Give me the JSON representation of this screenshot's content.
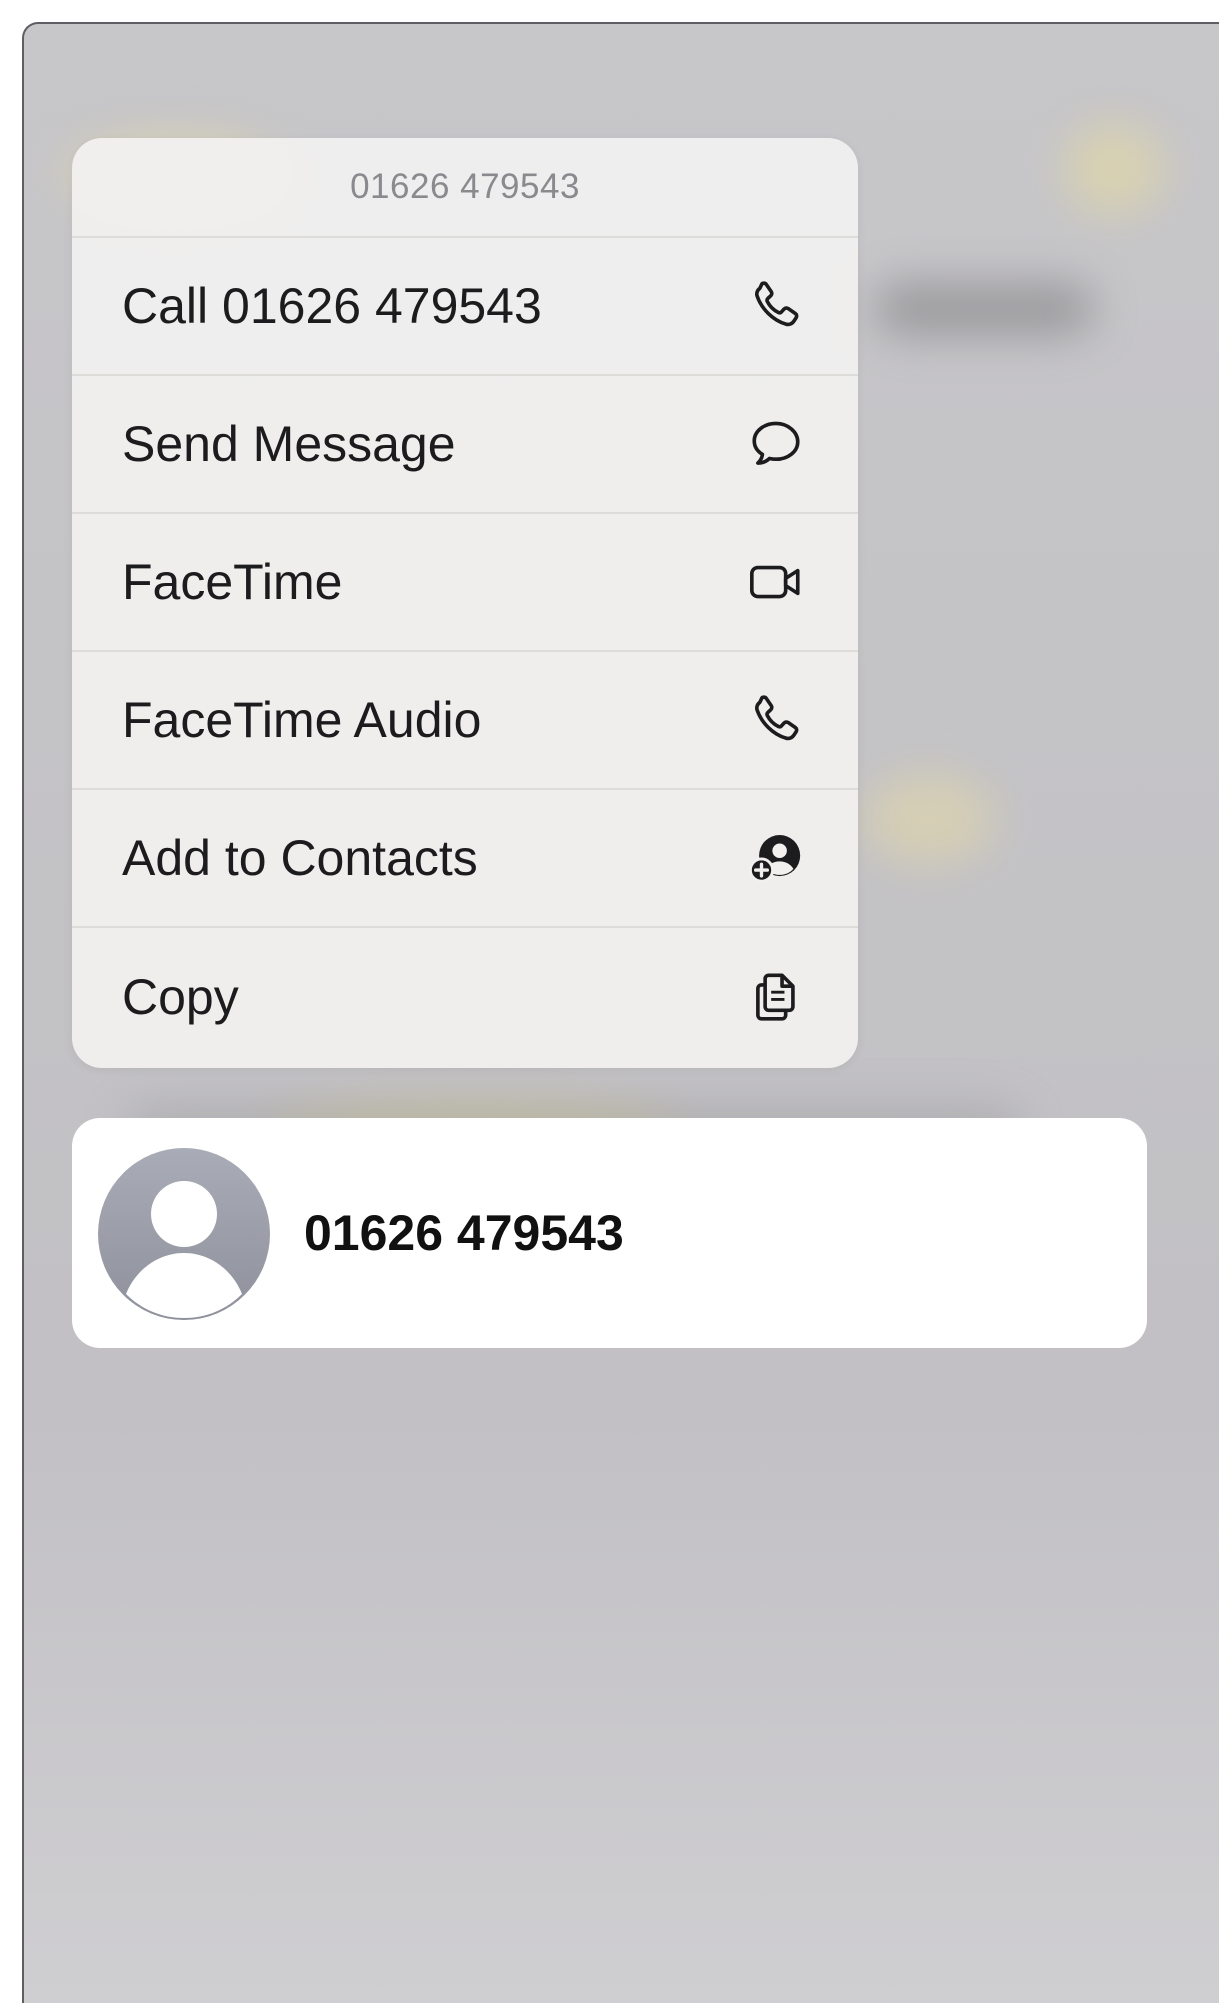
{
  "menu": {
    "header": "01626 479543",
    "items": [
      {
        "label": "Call 01626 479543",
        "icon": "phone-icon"
      },
      {
        "label": "Send Message",
        "icon": "message-bubble-icon"
      },
      {
        "label": "FaceTime",
        "icon": "video-camera-icon"
      },
      {
        "label": "FaceTime Audio",
        "icon": "phone-icon"
      },
      {
        "label": "Add to Contacts",
        "icon": "add-contact-icon"
      },
      {
        "label": "Copy",
        "icon": "copy-icon"
      }
    ]
  },
  "contact": {
    "name": "01626 479543",
    "avatar_icon": "person-placeholder-icon"
  },
  "colors": {
    "menu_background": "#f1f0ee",
    "header_text": "#8a898e",
    "item_text": "#1c1c1e",
    "card_background": "#ffffff",
    "avatar": "#9a9da7"
  }
}
